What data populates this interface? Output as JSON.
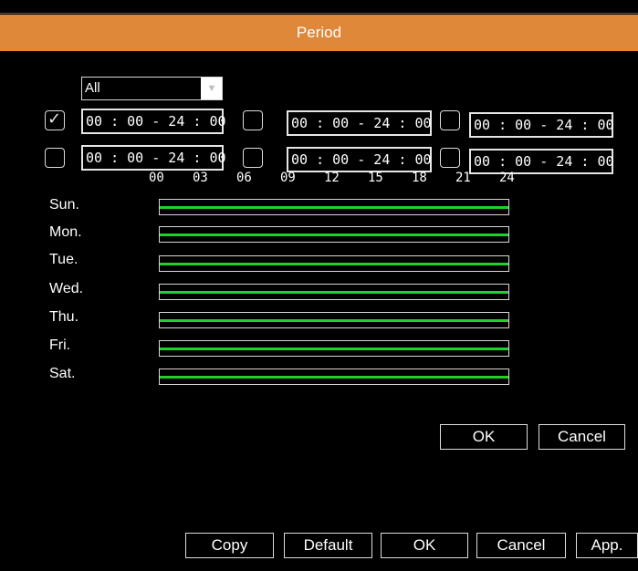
{
  "window": {
    "title": "Period"
  },
  "select": {
    "value": "All"
  },
  "time_slots": [
    {
      "checked": true,
      "range": "00 : 00 - 24 : 00"
    },
    {
      "checked": false,
      "range": "00 : 00 - 24 : 00"
    },
    {
      "checked": false,
      "range": "00 : 00 - 24 : 00"
    },
    {
      "checked": false,
      "range": "00 : 00 - 24 : 00"
    },
    {
      "checked": false,
      "range": "00 : 00 - 24 : 00"
    },
    {
      "checked": false,
      "range": "00 : 00 - 24 : 00"
    }
  ],
  "hours": [
    "00",
    "03",
    "06",
    "09",
    "12",
    "15",
    "18",
    "21",
    "24"
  ],
  "days": [
    "Sun.",
    "Mon.",
    "Tue.",
    "Wed.",
    "Thu.",
    "Fri.",
    "Sat."
  ],
  "schedule_fill": 1.0,
  "schedule_color": "#1fd12a",
  "accent_color": "#e0883a",
  "dialog_buttons": {
    "ok": "OK",
    "cancel": "Cancel"
  },
  "footer_buttons": {
    "copy": "Copy",
    "default": "Default",
    "ok": "OK",
    "cancel": "Cancel",
    "apply": "App."
  }
}
